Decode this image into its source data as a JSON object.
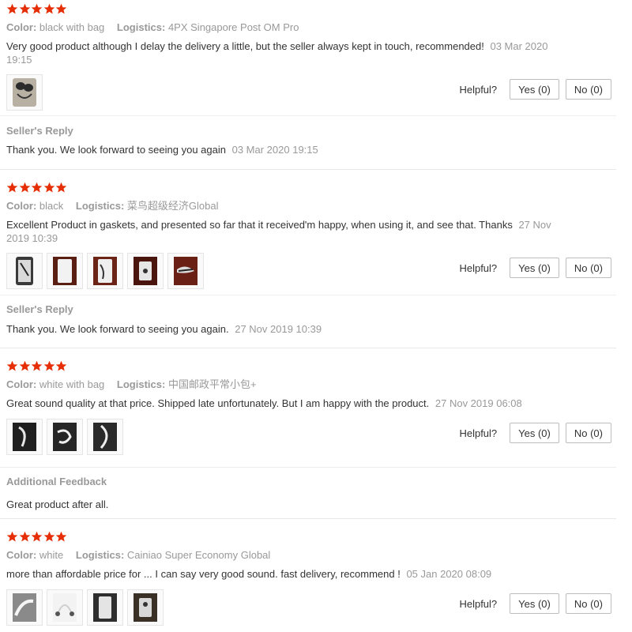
{
  "colors": {
    "star": "#e62e04",
    "label": "#999999",
    "text": "#333333"
  },
  "reviews": [
    {
      "rating": 5,
      "color_label": "Color:",
      "color_value": "black with bag",
      "logistics_label": "Logistics:",
      "logistics_value": "4PX Singapore Post OM Pro",
      "text": "Very good product although I delay the delivery a little, but the seller always kept in touch, recommended!",
      "date": "03 Mar 2020 19:15",
      "photos": 1,
      "helpful_label": "Helpful?",
      "yes_label": "Yes (0)",
      "no_label": "No (0)",
      "reply_title": "Seller's Reply",
      "reply_text": "Thank you. We look forward to seeing you again",
      "reply_date": "03 Mar 2020 19:15"
    },
    {
      "rating": 5,
      "color_label": "Color:",
      "color_value": "black",
      "logistics_label": "Logistics:",
      "logistics_value": "菜鸟超级经济Global",
      "text": "Excellent Product in gaskets, and presented so far that it received'm happy, when using it, and see that. Thanks",
      "date": "27 Nov 2019 10:39",
      "photos": 5,
      "helpful_label": "Helpful?",
      "yes_label": "Yes (0)",
      "no_label": "No (0)",
      "reply_title": "Seller's Reply",
      "reply_text": "Thank you. We look forward to seeing you again.",
      "reply_date": "27 Nov 2019 10:39"
    },
    {
      "rating": 5,
      "color_label": "Color:",
      "color_value": "white with bag",
      "logistics_label": "Logistics:",
      "logistics_value": "中国邮政平常小包+",
      "text": "Great sound quality at that price. Shipped late unfortunately. But I am happy with the product.",
      "date": "27 Nov 2019 06:08",
      "photos": 3,
      "helpful_label": "Helpful?",
      "yes_label": "Yes (0)",
      "no_label": "No (0)",
      "reply_title": "Additional Feedback",
      "reply_text": "Great product after all.",
      "reply_date": ""
    },
    {
      "rating": 5,
      "color_label": "Color:",
      "color_value": "white",
      "logistics_label": "Logistics:",
      "logistics_value": "Cainiao Super Economy Global",
      "text": "more than affordable price for ... I can say very good sound. fast delivery, recommend !",
      "date": "05 Jan 2020 08:09",
      "photos": 4,
      "helpful_label": "Helpful?",
      "yes_label": "Yes (0)",
      "no_label": "No (0)"
    }
  ]
}
